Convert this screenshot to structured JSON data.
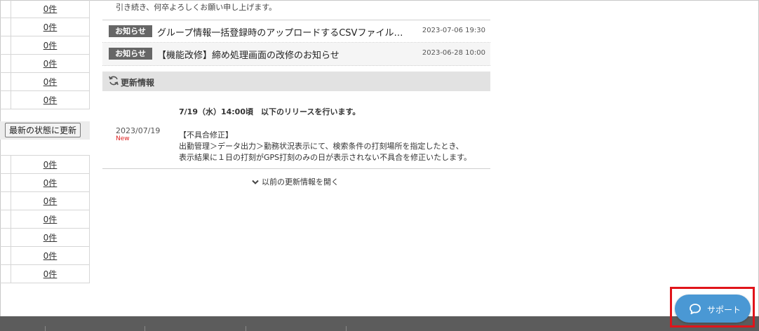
{
  "left_table_top": [
    {
      "count": "0件"
    },
    {
      "count": "0件"
    },
    {
      "count": "0件"
    },
    {
      "count": "0件"
    },
    {
      "count": "0件"
    },
    {
      "count": "0件"
    }
  ],
  "refresh_button": "最新の状態に更新",
  "left_table_bottom": [
    {
      "count": "0件"
    },
    {
      "count": "0件"
    },
    {
      "count": "0件"
    },
    {
      "count": "0件"
    },
    {
      "count": "0件"
    },
    {
      "count": "0件"
    },
    {
      "count": "0件"
    }
  ],
  "greeting": "引き続き、何卒よろしくお願い申し上げます。",
  "news": [
    {
      "badge": "お知らせ",
      "title": "グループ情報一括登録時のアップロードするCSVファイル…",
      "date": "2023-07-06 19:30"
    },
    {
      "badge": "お知らせ",
      "title": "【機能改修】締め処理画面の改修のお知らせ",
      "date": "2023-06-28 10:00"
    }
  ],
  "updates": {
    "header": "更新情報",
    "entry": {
      "date": "2023/07/19",
      "new_badge": "New",
      "headline": "7/19（水）14:00頃　以下のリリースを行います。",
      "section": "【不具合修正】",
      "line1": "出勤管理＞データ出力＞勤務状況表示にて、検索条件の打刻場所を指定したとき、",
      "line2": "表示結果に１日の打刻がGPS打刻のみの日が表示されない不具合を修正いたします。"
    },
    "more_link": "以前の更新情報を開く"
  },
  "support": {
    "label": "サポート"
  },
  "colors": {
    "accent": "#4a98d4",
    "badge": "#666666",
    "new": "#dd2222",
    "footer": "#5c5c5c",
    "highlight": "#e0141a"
  }
}
